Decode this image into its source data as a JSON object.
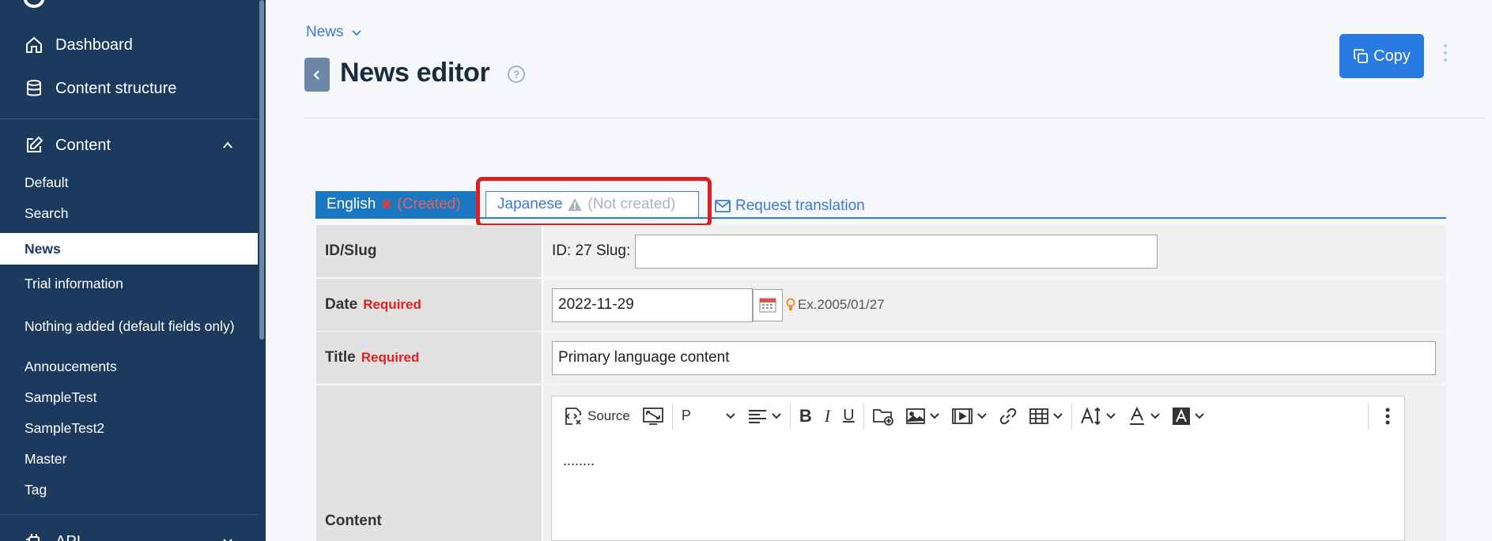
{
  "sidebar": {
    "main_items": [
      {
        "label": "Dashboard",
        "icon": "home-icon"
      },
      {
        "label": "Content structure",
        "icon": "database-icon"
      }
    ],
    "content_section": {
      "label": "Content",
      "icon": "edit-icon"
    },
    "sub_items": [
      {
        "label": "Default"
      },
      {
        "label": "Search"
      },
      {
        "label": "News",
        "active": true
      },
      {
        "label": "Trial information"
      },
      {
        "label": "Nothing added (default fields only)"
      },
      {
        "label": "Annoucements"
      },
      {
        "label": "SampleTest"
      },
      {
        "label": "SampleTest2"
      },
      {
        "label": "Master"
      },
      {
        "label": "Tag"
      }
    ],
    "api_section": {
      "label": "API",
      "icon": "api-icon"
    }
  },
  "header": {
    "breadcrumb": "News",
    "title": "News editor",
    "copy_label": "Copy"
  },
  "tabs": {
    "english": {
      "label": "English",
      "status": "(Created)"
    },
    "japanese": {
      "label": "Japanese",
      "status": "(Not created)"
    },
    "request_translation": "Request translation"
  },
  "form": {
    "id_slug": {
      "label": "ID/Slug",
      "id_text": "ID: 27 Slug:",
      "slug_value": ""
    },
    "date": {
      "label": "Date",
      "required": "Required",
      "value": "2022-11-29",
      "hint": "Ex.2005/01/27"
    },
    "title": {
      "label": "Title",
      "required": "Required",
      "value": "Primary language content"
    },
    "content": {
      "label": "Content",
      "body": "........",
      "toolbar": {
        "source_label": "Source",
        "paragraph_label": "P"
      }
    }
  },
  "colors": {
    "sidebar_bg": "#1c3a5e",
    "accent": "#2a7ae4",
    "required": "#e01e1e",
    "highlight_box": "#e01e1e"
  }
}
